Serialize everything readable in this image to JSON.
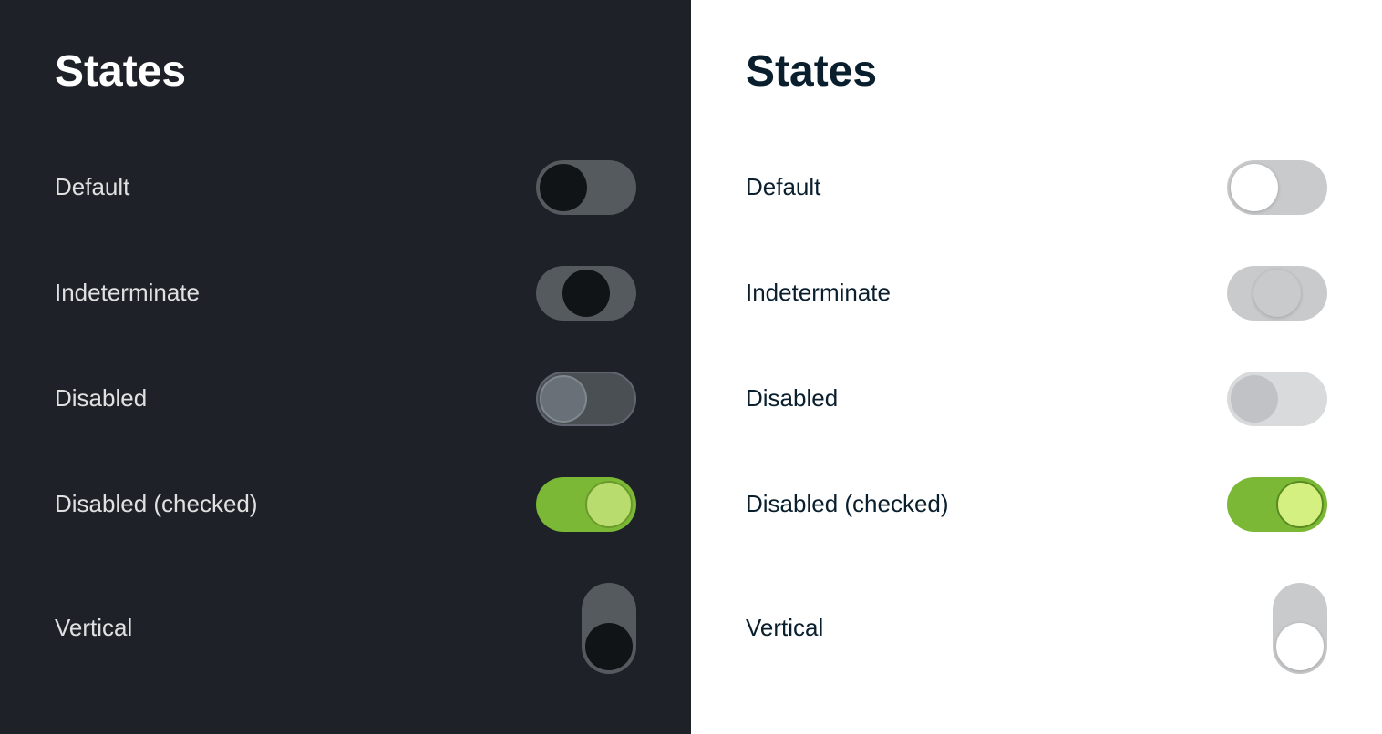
{
  "dark_panel": {
    "title": "States",
    "states": [
      {
        "id": "default",
        "label": "Default"
      },
      {
        "id": "indeterminate",
        "label": "Indeterminate"
      },
      {
        "id": "disabled",
        "label": "Disabled"
      },
      {
        "id": "disabled-checked",
        "label": "Disabled (checked)"
      },
      {
        "id": "vertical",
        "label": "Vertical"
      }
    ]
  },
  "light_panel": {
    "title": "States",
    "states": [
      {
        "id": "default",
        "label": "Default"
      },
      {
        "id": "indeterminate",
        "label": "Indeterminate"
      },
      {
        "id": "disabled",
        "label": "Disabled"
      },
      {
        "id": "disabled-checked",
        "label": "Disabled (checked)"
      },
      {
        "id": "vertical",
        "label": "Vertical"
      }
    ]
  }
}
